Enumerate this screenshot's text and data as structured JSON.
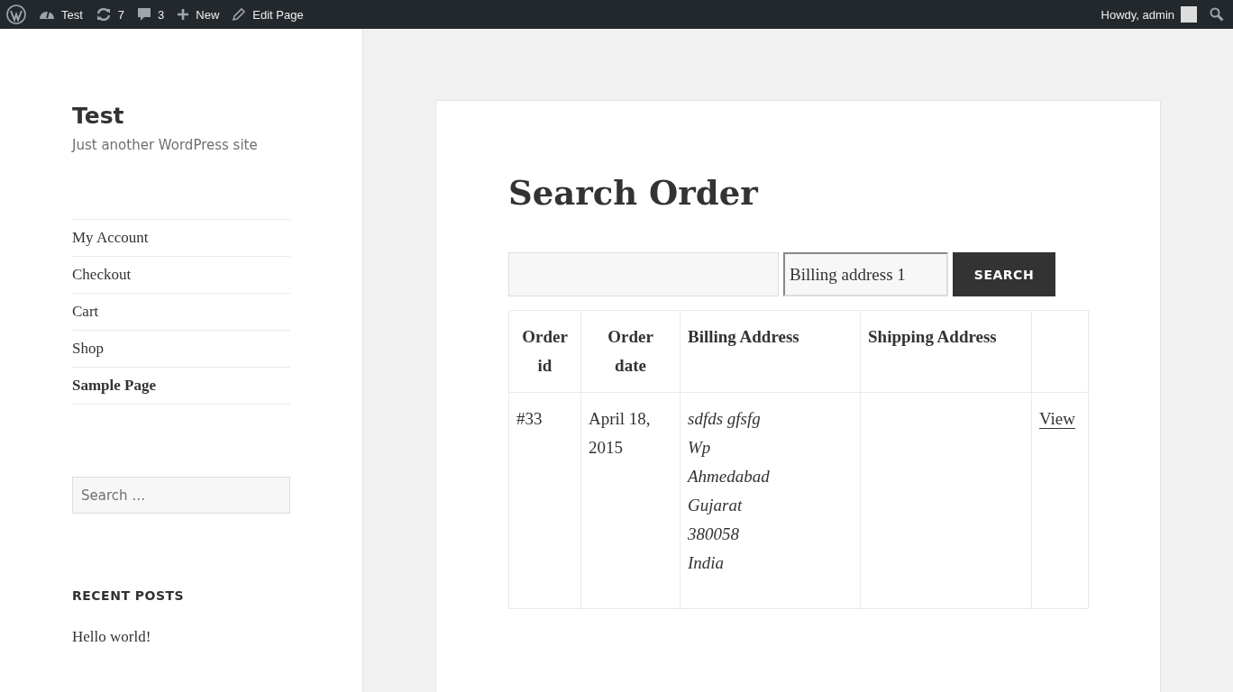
{
  "admin_bar": {
    "items": [
      {
        "kind": "logo"
      },
      {
        "kind": "site",
        "label": "Test"
      },
      {
        "kind": "updates",
        "label": "7"
      },
      {
        "kind": "comments",
        "label": "3"
      },
      {
        "kind": "new",
        "label": "New"
      },
      {
        "kind": "edit",
        "label": "Edit Page"
      }
    ],
    "account": "Howdy, admin"
  },
  "site": {
    "title": "Test",
    "tagline": "Just another WordPress site"
  },
  "nav": [
    {
      "label": "My Account",
      "selected": false
    },
    {
      "label": "Checkout",
      "selected": false
    },
    {
      "label": "Cart",
      "selected": false
    },
    {
      "label": "Shop",
      "selected": false
    },
    {
      "label": "Sample Page",
      "selected": true
    }
  ],
  "sidebar_search": {
    "placeholder": "Search …"
  },
  "recent_posts": {
    "heading": "RECENT POSTS",
    "items": [
      "Hello world!"
    ]
  },
  "page": {
    "title": "Search Order",
    "filter": {
      "value": "Billing address 1"
    },
    "button": "SEARCH"
  },
  "table": {
    "columns": [
      "Order id",
      "Order date",
      "Billing Address",
      "Shipping Address"
    ],
    "rows": [
      {
        "order_id": "#33",
        "order_date": "April 18, 2015",
        "billing_address": [
          "sdfds gfsfg",
          "Wp",
          "Ahmedabad",
          "Gujarat",
          "380058",
          "India"
        ],
        "link": "View"
      }
    ]
  }
}
